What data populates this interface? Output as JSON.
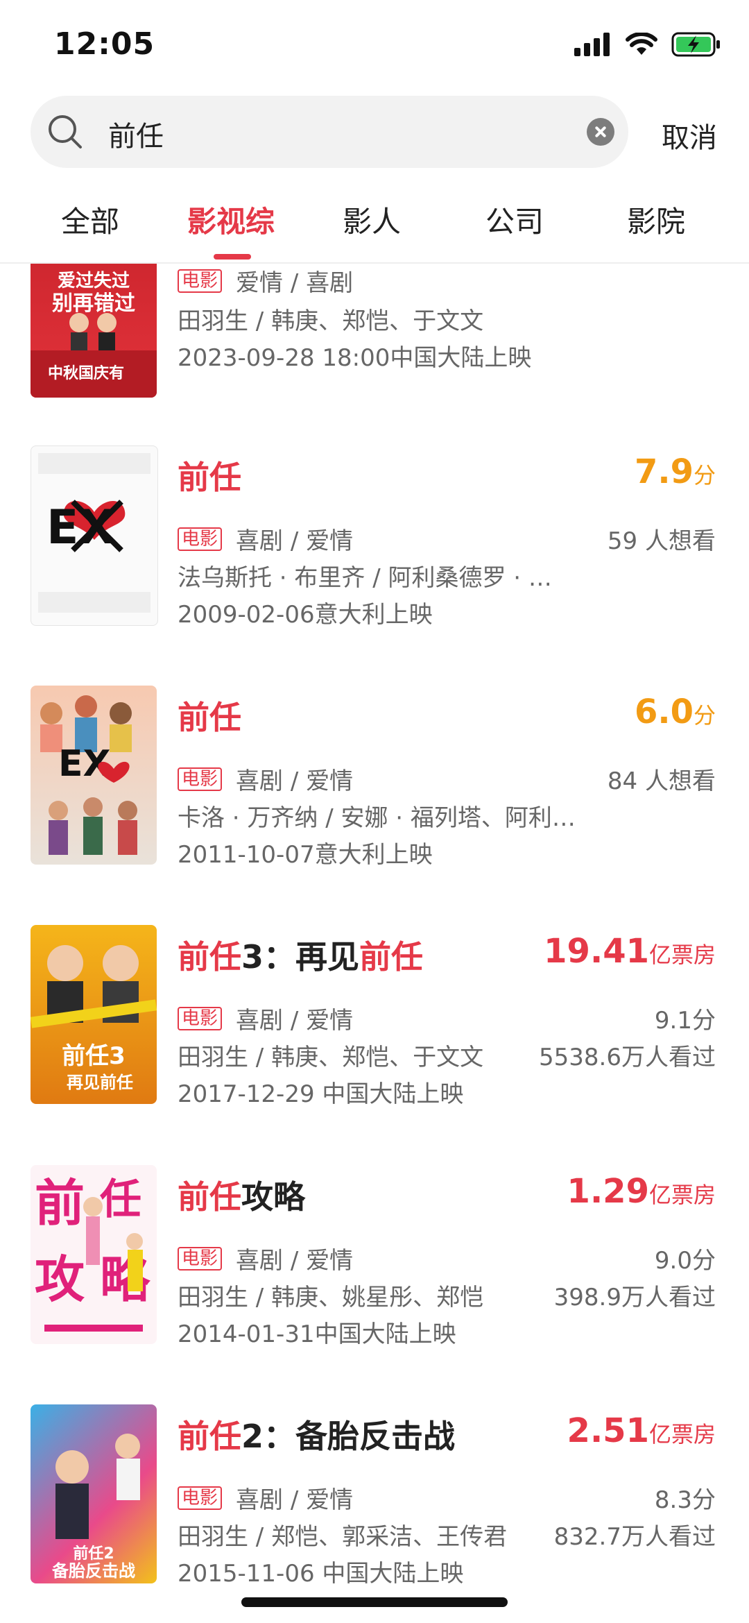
{
  "status_bar": {
    "time": "12:05",
    "icons": [
      "signal-icon",
      "wifi-icon",
      "battery-charging-icon"
    ]
  },
  "search": {
    "query": "前任",
    "cancel_label": "取消"
  },
  "tabs": [
    {
      "label": "全部",
      "active": false
    },
    {
      "label": "影视综",
      "active": true
    },
    {
      "label": "影人",
      "active": false
    },
    {
      "label": "公司",
      "active": false
    },
    {
      "label": "影院",
      "active": false
    }
  ],
  "results": [
    {
      "poster_text": "爱过失过 别再错过 中秋国庆有",
      "tag": "电影",
      "genres": "爱情 / 喜剧",
      "people": "田羽生 / 韩庚、郑恺、于文文",
      "release": "2023-09-28 18:00中国大陆上映"
    },
    {
      "poster_text": "EX",
      "title_highlight": "前任",
      "title_rest": "",
      "score_value": "7.9",
      "score_unit": "分",
      "tag": "电影",
      "genres": "喜剧 / 爱情",
      "right_line": "59 人想看",
      "people": "法乌斯托 · 布里齐  / 阿利桑德罗 · …",
      "release": "2009-02-06意大利上映"
    },
    {
      "poster_text": "EX",
      "title_highlight": "前任",
      "title_rest": "",
      "score_value": "6.0",
      "score_unit": "分",
      "tag": "电影",
      "genres": "喜剧 / 爱情",
      "right_line": "84 人想看",
      "people": "卡洛 · 万齐纳 / 安娜 · 福列塔、阿利…",
      "release": "2011-10-07意大利上映"
    },
    {
      "poster_text": "前任3 再见前任",
      "title_parts": [
        "前任",
        "3：再见",
        "前任"
      ],
      "box_value": "19.41",
      "box_unit": "亿票房",
      "tag": "电影",
      "genres": "喜剧 / 爱情",
      "right_score": "9.1分",
      "right_viewers": "5538.6万人看过",
      "people": "田羽生 / 韩庚、郑恺、于文文",
      "release": "2017-12-29 中国大陆上映"
    },
    {
      "poster_text": "前任 攻略",
      "title_parts": [
        "前任",
        "攻略"
      ],
      "box_value": "1.29",
      "box_unit": "亿票房",
      "tag": "电影",
      "genres": "喜剧 / 爱情",
      "right_score": "9.0分",
      "right_viewers": "398.9万人看过",
      "people": "田羽生 / 韩庚、姚星彤、郑恺",
      "release": "2014-01-31中国大陆上映"
    },
    {
      "poster_text": "前任2 备胎反击战",
      "title_parts": [
        "前任",
        "2：备胎反击战"
      ],
      "box_value": "2.51",
      "box_unit": "亿票房",
      "tag": "电影",
      "genres": "喜剧 / 爱情",
      "right_score": "8.3分",
      "right_viewers": "832.7万人看过",
      "people": "田羽生 / 郑恺、郭采洁、王传君",
      "release": "2015-11-06 中国大陆上映"
    }
  ]
}
